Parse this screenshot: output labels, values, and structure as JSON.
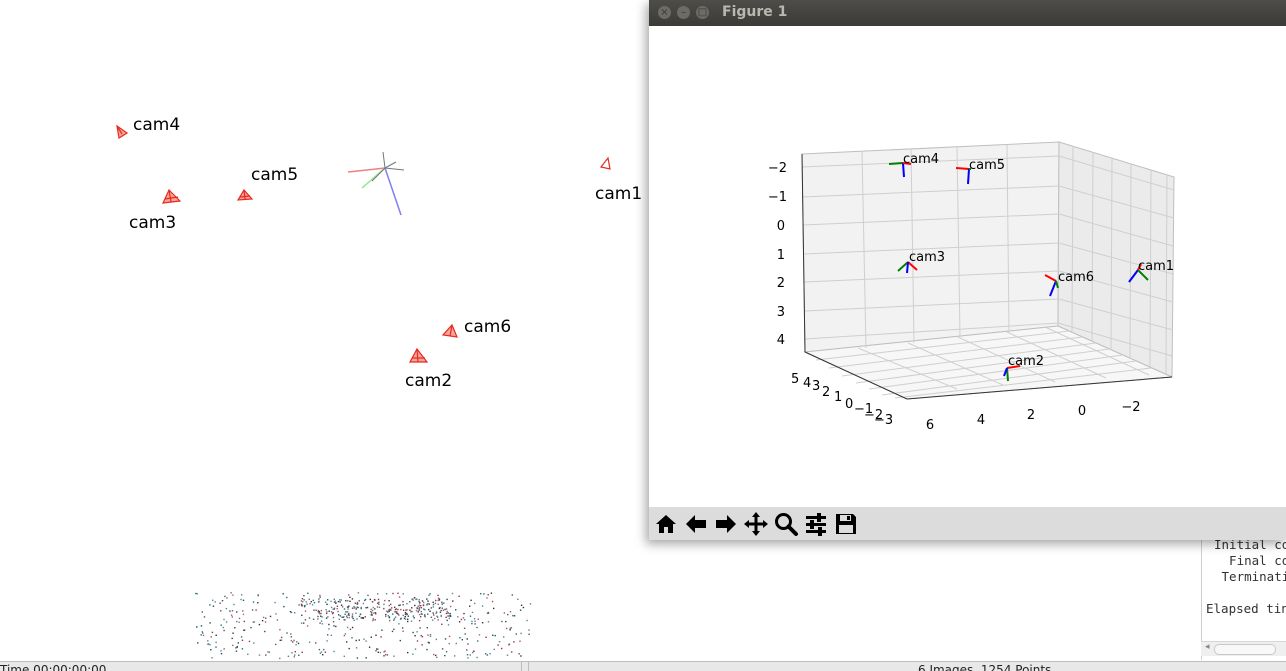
{
  "scene": {
    "cameras": [
      {
        "label": "cam4"
      },
      {
        "label": "cam5"
      },
      {
        "label": "cam3"
      },
      {
        "label": "cam1"
      },
      {
        "label": "cam6"
      },
      {
        "label": "cam2"
      }
    ],
    "colors": {
      "frustum": "#e8291c",
      "frustum_fill": "#f7a59c"
    }
  },
  "console": {
    "lines": [
      "Initial co",
      "  Final co",
      " Terminati",
      "",
      "Elapsed tin"
    ]
  },
  "statusbar": {
    "left": "Time 00:00:00:00",
    "right": "6 Images, 1254 Points"
  },
  "figure": {
    "title": "Figure 1",
    "window_buttons": [
      "close",
      "minimize",
      "maximize"
    ],
    "plot": {
      "z_ticks": [
        "−2",
        "−1",
        "0",
        "1",
        "2",
        "3",
        "4"
      ],
      "x_ticks": [
        "6",
        "4",
        "2",
        "0",
        "−2"
      ],
      "y_ticks": [
        "5",
        "4",
        "3",
        "2",
        "1",
        "0",
        "−1",
        "−2",
        "−3"
      ],
      "camera_labels": [
        "cam4",
        "cam5",
        "cam3",
        "cam6",
        "cam1",
        "cam2"
      ],
      "axis_colors": {
        "x": "#ff0000",
        "y": "#008000",
        "z": "#0000ff"
      }
    },
    "toolbar": [
      "home-icon",
      "back-icon",
      "forward-icon",
      "pan-icon",
      "zoom-icon",
      "configure-subplots-icon",
      "save-icon"
    ]
  }
}
